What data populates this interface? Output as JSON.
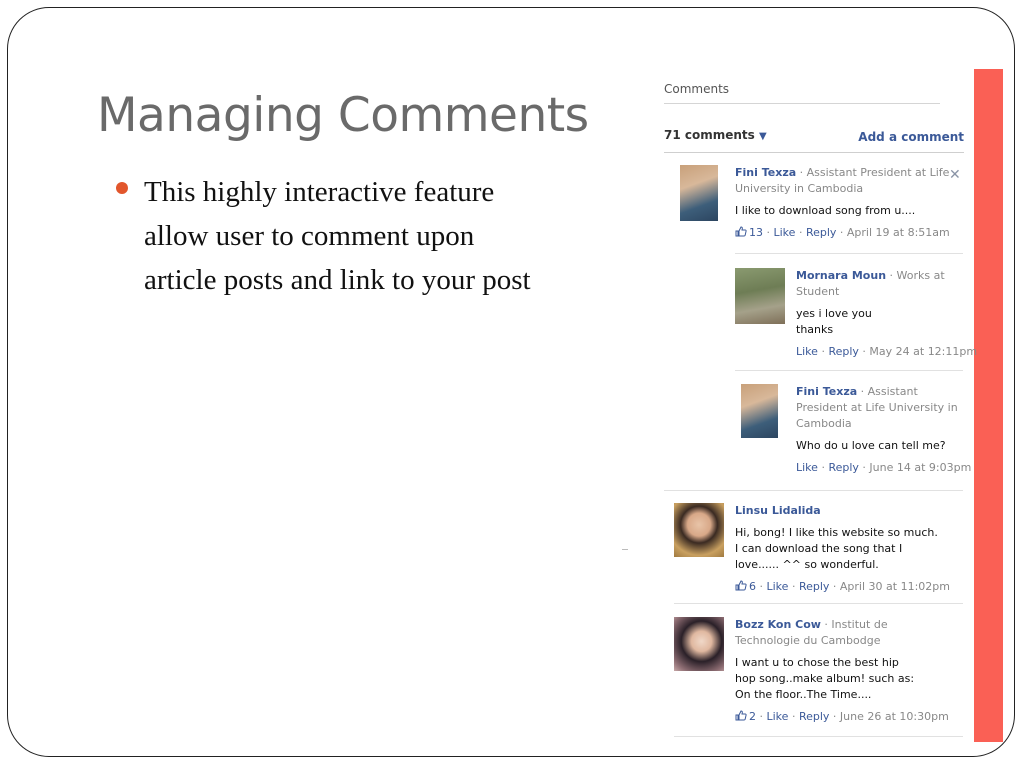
{
  "slide": {
    "title": "Managing Comments",
    "bullet_lines": [
      "This highly interactive feature",
      "allow user to comment upon",
      "article posts and link to your post"
    ]
  },
  "fb": {
    "heading": "Comments",
    "count_label": "71 comments",
    "add_comment_label": "Add a comment",
    "comments": [
      {
        "name": "Fini Texza",
        "work": "Assistant President at Life University in Cambodia",
        "message": "I like to download song from u....",
        "likes": "13",
        "like_label": "Like",
        "reply_label": "Reply",
        "timestamp": "April 19 at 8:51am"
      },
      {
        "name": "Mornara Moun",
        "work": "Works at Student",
        "message": "yes i love you\nthanks",
        "likes": "",
        "like_label": "Like",
        "reply_label": "Reply",
        "timestamp": "May 24 at 12:11pm"
      },
      {
        "name": "Fini Texza",
        "work": "Assistant President at Life University in Cambodia",
        "message": "Who do u love can tell me?",
        "likes": "",
        "like_label": "Like",
        "reply_label": "Reply",
        "timestamp": "June 14 at 9:03pm"
      },
      {
        "name": "Linsu Lidalida",
        "work": "",
        "message": "Hi, bong! I like this website so much. I can download the song that I love...... ^^ so wonderful.",
        "likes": "6",
        "like_label": "Like",
        "reply_label": "Reply",
        "timestamp": "April 30 at 11:02pm"
      },
      {
        "name": "Bozz Kon Cow",
        "work": "Institut de Technologie du Cambodge",
        "message": "I want u to chose the best hip hop song..make album! such as: On the floor..The Time....",
        "likes": "2",
        "like_label": "Like",
        "reply_label": "Reply",
        "timestamp": "June 26 at 10:30pm"
      }
    ]
  },
  "colors": {
    "accent_bar": "#fa6055",
    "bullet": "#e2562c",
    "fb_link": "#3b5998",
    "title": "#6a6a6a"
  },
  "icons": {
    "close": "close-icon",
    "thumb": "thumbs-up-icon",
    "caret": "caret-down-icon"
  }
}
